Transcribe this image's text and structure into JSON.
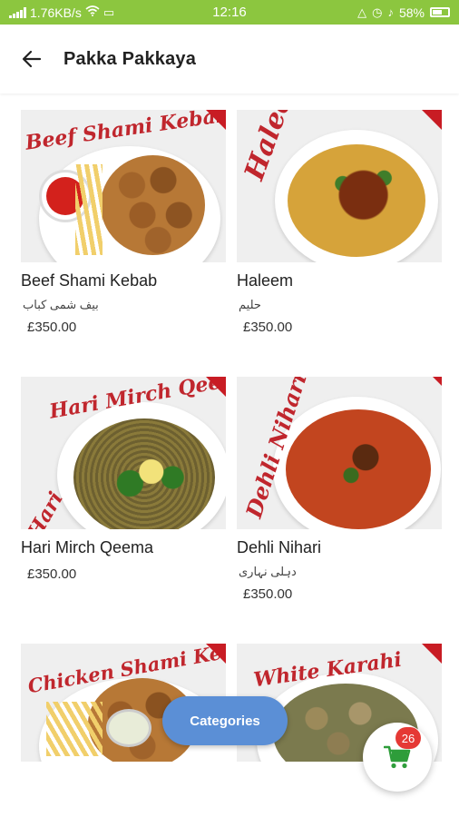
{
  "status_bar": {
    "network_speed": "1.76KB/s",
    "time": "12:16",
    "battery": "58%"
  },
  "header": {
    "title": "Pakka Pakkaya",
    "back_icon": "arrow-left-icon"
  },
  "products": [
    {
      "name": "Beef Shami Kebab",
      "urdu": "بیف شمی کباب",
      "price": "£350.00",
      "image_text": "Beef Shami Kebab"
    },
    {
      "name": "Haleem",
      "urdu": "حلیم",
      "price": "£350.00",
      "image_text": "Haleem"
    },
    {
      "name": "Hari Mirch Qeema",
      "urdu": "",
      "price": "£350.00",
      "image_text": "Hari Mirch Qeema"
    },
    {
      "name": "Dehli Nihari",
      "urdu": "دہلی نہاری",
      "price": "£350.00",
      "image_text": "Dehli Nihari"
    },
    {
      "name": "",
      "urdu": "",
      "price": "",
      "image_text": "Chicken Shami Kebab"
    },
    {
      "name": "",
      "urdu": "",
      "price": "",
      "image_text": "White Karahi"
    }
  ],
  "categories_button": {
    "label": "Categories"
  },
  "cart": {
    "count": "26",
    "icon": "shopping-cart-icon"
  },
  "colors": {
    "status_bar": "#8cc63f",
    "accent_blue": "#5b8fd6",
    "brand_red": "#c0262d",
    "cart_green": "#2e9d3a",
    "badge_red": "#e53935"
  }
}
